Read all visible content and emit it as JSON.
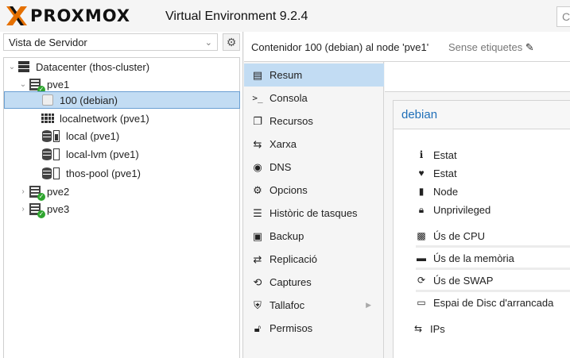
{
  "header": {
    "brand": "PROXMOX",
    "version_label": "Virtual Environment 9.2.4",
    "search_partial": "C"
  },
  "left": {
    "view_select": "Vista de Servidor",
    "tree": [
      {
        "label": "Datacenter (thos-cluster)"
      },
      {
        "label": "pve1"
      },
      {
        "label": "100 (debian)"
      },
      {
        "label": "localnetwork (pve1)"
      },
      {
        "label": "local (pve1)"
      },
      {
        "label": "local-lvm (pve1)"
      },
      {
        "label": "thos-pool (pve1)"
      },
      {
        "label": "pve2"
      },
      {
        "label": "pve3"
      }
    ]
  },
  "topbar": {
    "title": "Contenidor 100 (debian) al node 'pve1'",
    "tags": "Sense etiquetes"
  },
  "menu": {
    "items": [
      {
        "label": "Resum",
        "icon": "book-icon"
      },
      {
        "label": "Consola",
        "icon": "terminal-icon"
      },
      {
        "label": "Recursos",
        "icon": "cube-icon"
      },
      {
        "label": "Xarxa",
        "icon": "exchange-icon"
      },
      {
        "label": "DNS",
        "icon": "globe-icon"
      },
      {
        "label": "Opcions",
        "icon": "gear-icon"
      },
      {
        "label": "Històric de tasques",
        "icon": "list-icon"
      },
      {
        "label": "Backup",
        "icon": "floppy-icon"
      },
      {
        "label": "Replicació",
        "icon": "retweet-icon"
      },
      {
        "label": "Captures",
        "icon": "history-icon"
      },
      {
        "label": "Tallafoc",
        "icon": "shield-icon"
      },
      {
        "label": "Permisos",
        "icon": "unlock-icon"
      }
    ]
  },
  "summary": {
    "title": "debian",
    "rows": [
      {
        "label": "Estat",
        "icon": "info-icon"
      },
      {
        "label": "Estat",
        "icon": "heartbeat-icon"
      },
      {
        "label": "Node",
        "icon": "building-icon"
      },
      {
        "label": "Unprivileged",
        "icon": "lock-icon"
      },
      {
        "label": "Ús de CPU",
        "icon": "cpu-icon"
      },
      {
        "label": "Ús de la memòria",
        "icon": "memory-icon"
      },
      {
        "label": "Ús de SWAP",
        "icon": "refresh-icon"
      },
      {
        "label": "Espai de Disc d'arrancada",
        "icon": "hdd-icon"
      },
      {
        "label": "IPs",
        "icon": "exchange-icon"
      }
    ]
  },
  "colors": {
    "selection": "#c2dcf3",
    "link_blue": "#1f6fb8",
    "status_ok": "#2fa52f",
    "logo_orange": "#e57000"
  }
}
